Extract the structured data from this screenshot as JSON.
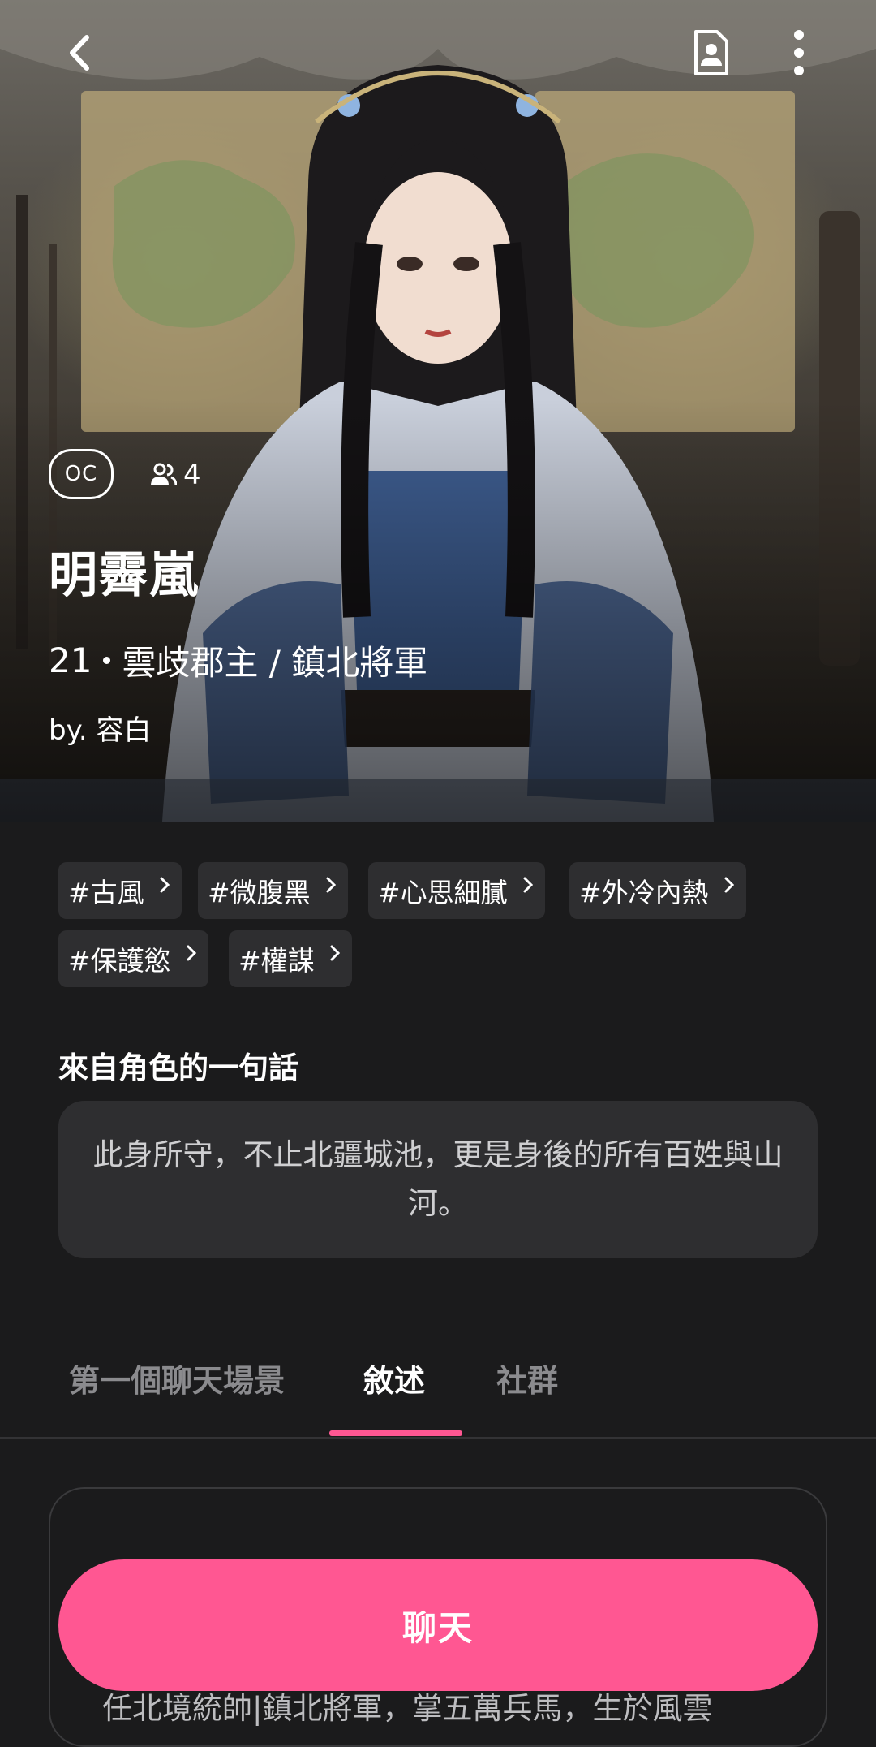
{
  "character": {
    "badge": "OC",
    "user_count": "4",
    "name": "明霽嵐",
    "age": "21",
    "title": "雲歧郡主 / 鎮北將軍",
    "author": "by. 容白"
  },
  "tags": [
    "#古風",
    "#微腹黑",
    "#心思細膩",
    "#外冷內熱",
    "#保護慾",
    "#權謀"
  ],
  "quote": {
    "heading": "來自角色的一句話",
    "text": "此身所守，不止北疆城池，更是身後的所有百姓與山河。"
  },
  "tabs": [
    "第一個聊天場景",
    "敘述",
    "社群"
  ],
  "active_tab": "敘述",
  "narrative": {
    "preview": "任北境統帥|鎮北將軍，掌五萬兵馬，生於風雲"
  },
  "chat_button": "聊天",
  "colors": {
    "accent": "#ff5792",
    "background": "#1b1b1c",
    "chip": "#2e2e30"
  },
  "icons": [
    "back-icon",
    "character-profile-icon",
    "more-vertical-icon",
    "users-icon",
    "chevron-right-icon"
  ]
}
